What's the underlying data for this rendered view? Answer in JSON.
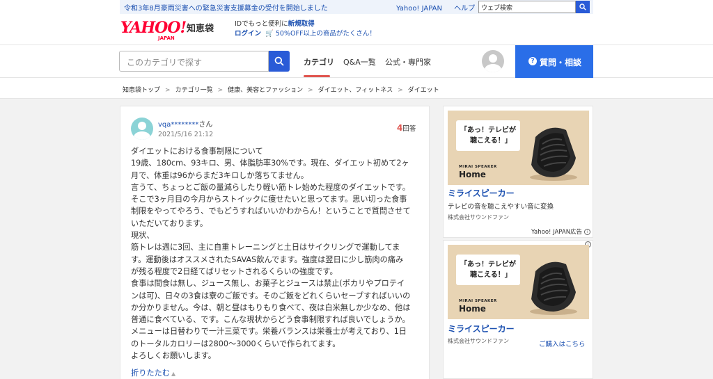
{
  "top": {
    "notice": "令和3年8月豪雨災害への緊急災害支援募金の受付を開始しました",
    "links": [
      "Yahoo! JAPAN",
      "ヘルプ"
    ],
    "web_search_placeholder": "ウェブ検索"
  },
  "header": {
    "logo_text": "YAHOO!",
    "logo_sub_text": "JAPAN",
    "service": "知恵袋",
    "promo_line1_prefix": "IDでもっと便利に",
    "promo_line1_link": "新規取得",
    "promo_login": "ログイン",
    "promo_cart_icon": "🛒",
    "promo_offer": "50%OFF以上の商品がたくさん！"
  },
  "nav": {
    "search_placeholder": "このカテゴリで探す",
    "tabs": [
      "カテゴリ",
      "Q&A一覧",
      "公式・専門家"
    ],
    "ask_button_icon": "?",
    "ask_button": "質問・相談"
  },
  "breadcrumb": [
    "知恵袋トップ",
    "カテゴリ一覧",
    "健康、美容とファッション",
    "ダイエット、フィットネス",
    "ダイエット"
  ],
  "breadcrumb_sep": ">",
  "question": {
    "user": "vqa********",
    "user_suffix": "さん",
    "date": "2021/5/16 21:12",
    "answer_count": "4",
    "answer_label": "回答",
    "body_lines": [
      "ダイエットにおける食事制限について",
      "19歳、180cm、93キロ、男、体脂肪率30%です。現在、ダイエット初めて2ヶ",
      "月で、体重は96からまだ3キロしか落ちてません。",
      "言うて、ちょっとご飯の量減らしたり軽い筋トレ始めた程度のダイエットです。",
      "そこで3ヶ月目の今月からストイックに痩せたいと思ってます。思い切った食事",
      "制限をやってやろう、でもどうすればいいかわからん！ということで質問させて",
      "いただいております。",
      "現状、",
      "筋トレは週に3回、主に自重トレーニングと土日はサイクリングで運動してま",
      "す。運動後はオススメされたSAVAS飲んでます。強度は翌日に少し筋肉の痛み",
      "が残る程度で2日経てばリセットされるくらいの強度です。",
      "食事は間食は無し、ジュース無し、お菓子とジュースは禁止(ポカリやプロテイ",
      "ンは可)、日々の3食は寮のご飯です。そのご飯をどれくらいセーブすればいいの",
      "か分かりません。今は、朝と昼はもりもり食べて、夜は白米無しか少なめ、他は",
      "普通に食べている、です。こんな現状からどう食事制限すれば良いでしょうか。",
      "メニューは日替わりで一汁三菜です。栄養バランスは栄養士が考えており、1日",
      "のトータルカロリーは2800〜3000くらいで作られてます。",
      "よろしくお願いします。"
    ],
    "fold_label": "折りたたむ",
    "fold_icon": "▲"
  },
  "ads": [
    {
      "bubble_line1": "「あっ！テレビが",
      "bubble_line2": "聴こえる！」",
      "brand_small": "MIRAI SPEAKER",
      "brand_large": "Home",
      "title": "ミライスピーカー",
      "desc": "テレビの音を聴こえやすい音に変換",
      "company": "株式会社サウンドファン",
      "label": "Yahoo! JAPAN広告",
      "info_icon": "i"
    },
    {
      "bubble_line1": "「あっ！テレビが",
      "bubble_line2": "聴こえる！」",
      "brand_small": "MIRAI SPEAKER",
      "brand_large": "Home",
      "title": "ミライスピーカー",
      "company": "株式会社サウンドファン",
      "buy": "ご購入はこちら",
      "info_icon": "i"
    }
  ],
  "colors": {
    "link": "#1a4fb0",
    "brand_red": "#ff0033",
    "primary_button": "#2a6ee8",
    "accent": "#e0554f"
  }
}
